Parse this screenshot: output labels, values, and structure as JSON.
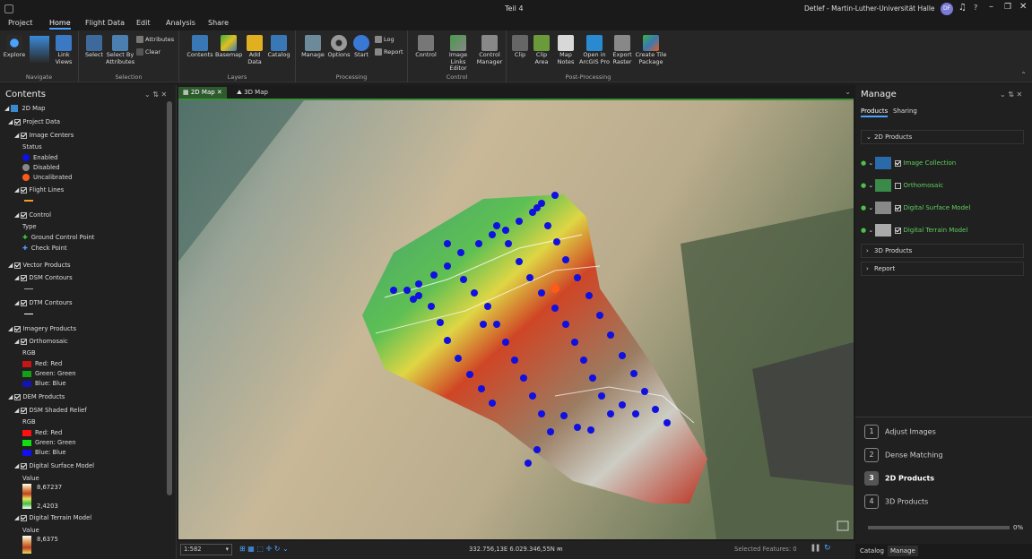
{
  "window": {
    "title": "Teil 4",
    "user": "Detlef - Martin-Luther-Universität Halle",
    "avatar": "DF",
    "help": "?"
  },
  "tabs": [
    "Project",
    "Home",
    "Flight Data",
    "Edit",
    "Analysis",
    "Share"
  ],
  "ribbon": {
    "navigate": {
      "label": "Navigate",
      "explore": "Explore",
      "link_views": "Link Views"
    },
    "selection": {
      "label": "Selection",
      "select": "Select",
      "select_by_attributes": "Select By Attributes",
      "attributes": "Attributes",
      "clear": "Clear"
    },
    "layers": {
      "label": "Layers",
      "contents": "Contents",
      "basemap": "Basemap",
      "add_data": "Add Data",
      "catalog": "Catalog"
    },
    "processing": {
      "label": "Processing",
      "manage": "Manage",
      "options": "Options",
      "start": "Start",
      "log": "Log",
      "report": "Report"
    },
    "control": {
      "label": "Control",
      "control": "Control",
      "image_links_editor": "Image Links Editor",
      "control_manager": "Control Manager"
    },
    "post": {
      "label": "Post-Processing",
      "clip": "Clip",
      "clip_area": "Clip Area",
      "map_notes": "Map Notes",
      "open_in_pro": "Open in ArcGIS Pro",
      "export_raster": "Export Raster",
      "create_tile_package": "Create Tile Package"
    }
  },
  "contents": {
    "title": "Contents",
    "map": "2D Map",
    "project_data": "Project Data",
    "image_centers": "Image Centers",
    "status": "Status",
    "enabled": "Enabled",
    "disabled": "Disabled",
    "uncalibrated": "Uncalibrated",
    "flight_lines": "Flight Lines",
    "control": "Control",
    "type": "Type",
    "gcp": "Ground Control Point",
    "check_point": "Check Point",
    "vector_products": "Vector Products",
    "dsm_contours": "DSM Contours",
    "dtm_contours": "DTM Contours",
    "imagery_products": "Imagery Products",
    "orthomosaic": "Orthomosaic",
    "rgb": "RGB",
    "red": "Red:  Red",
    "green": "Green: Green",
    "blue": "Blue:  Blue",
    "dem_products": "DEM Products",
    "dsm_shaded_relief": "DSM Shaded Relief",
    "dsm": "Digital Surface Model",
    "value": "Value",
    "dsm_max": "8,67237",
    "dsm_min": "2,4203",
    "dtm": "Digital Terrain Model",
    "dtm_max": "8,6375"
  },
  "map": {
    "tab_2d": "2D Map",
    "tab_3d": "3D Map",
    "scale": "1:582",
    "coords": "332.756,13E 6.029.346,55N m",
    "selected": "Selected Features: 0"
  },
  "manage": {
    "title": "Manage",
    "tab_products": "Products",
    "tab_sharing": "Sharing",
    "sec_2d": "2D Products",
    "items": [
      "Image Collection",
      "Orthomosaic",
      "Digital Surface Model",
      "Digital Terrain Model"
    ],
    "sec_3d": "3D Products",
    "sec_report": "Report",
    "steps": [
      "Adjust Images",
      "Dense Matching",
      "2D Products",
      "3D Products"
    ],
    "progress": "0%",
    "bottom_catalog": "Catalog",
    "bottom_manage": "Manage"
  },
  "colors": {
    "accent": "#4aa3ff",
    "enabled": "#1010e0",
    "disabled": "#888888",
    "uncalibrated": "#ff5a1a",
    "product_link": "#5fcf5f"
  }
}
